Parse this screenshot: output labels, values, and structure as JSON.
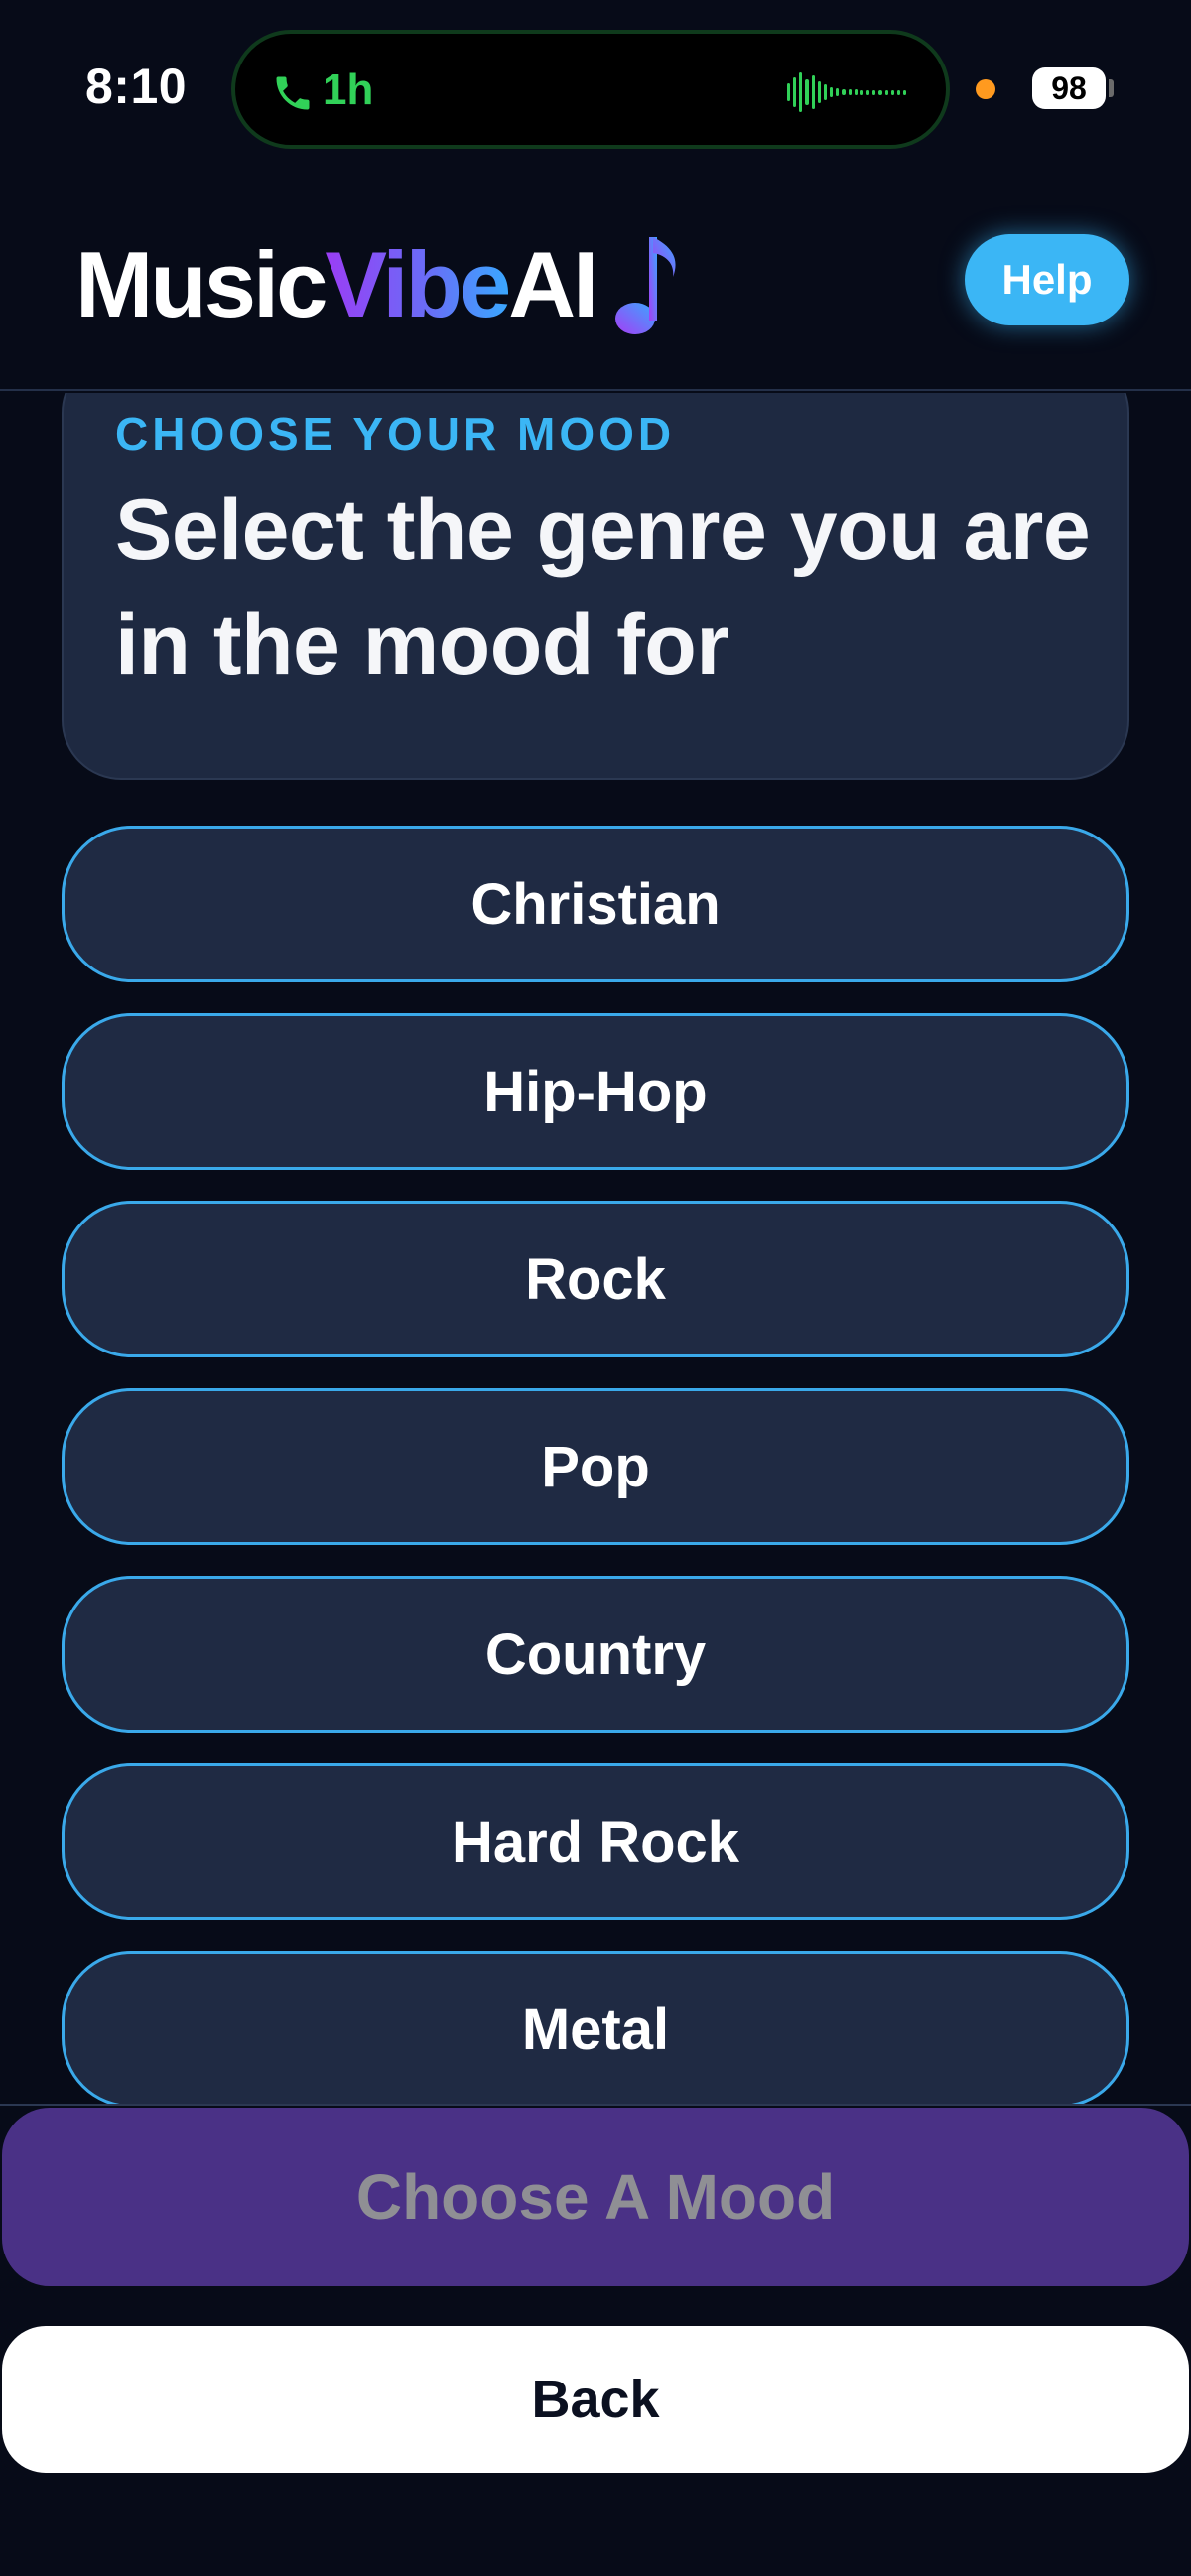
{
  "status_bar": {
    "time": "8:10",
    "call_duration": "1h",
    "battery": "98",
    "call_icon": "phone-icon",
    "call_color": "#31d158",
    "mic_indicator_color": "#ff9a1f"
  },
  "header": {
    "logo_parts": [
      "Music",
      "Vibe",
      "AI"
    ],
    "logo_icon": "music-note-icon",
    "help_label": "Help",
    "accent": "#3bb6f5"
  },
  "intro": {
    "eyebrow": "CHOOSE YOUR MOOD",
    "headline": "Select the genre you are in the mood for"
  },
  "genres": [
    "Christian",
    "Hip-Hop",
    "Rock",
    "Pop",
    "Country",
    "Hard Rock",
    "Metal"
  ],
  "footer": {
    "choose_label": "Choose A Mood",
    "back_label": "Back",
    "choose_color": "#4a3186"
  }
}
